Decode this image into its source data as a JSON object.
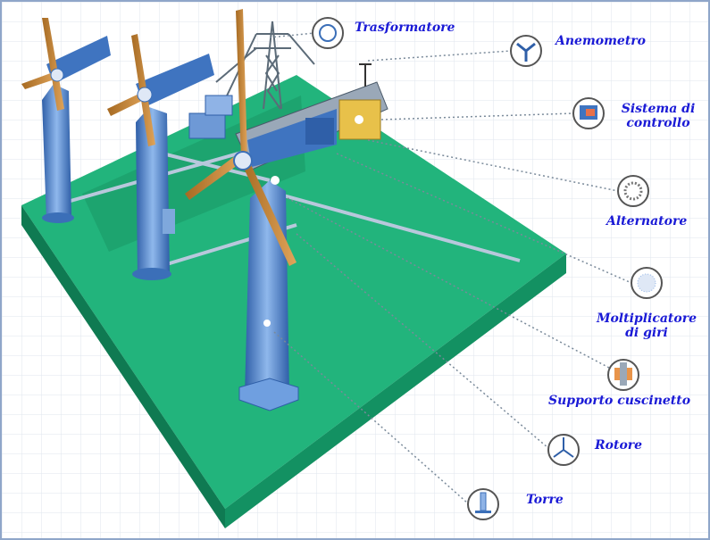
{
  "labels": {
    "trasformatore": "Trasformatore",
    "anemometro": "Anemometro",
    "sistema_line1": "Sistema di",
    "sistema_line2": "controllo",
    "alternatore": "Alternatore",
    "moltiplicatore_line1": "Moltiplicatore",
    "moltiplicatore_line2": "di giri",
    "supporto": "Supporto cuscinetto",
    "rotore": "Rotore",
    "torre": "Torre"
  },
  "colors": {
    "label_text": "#1a1ad6",
    "platform_top": "#1fb37a",
    "platform_side": "#0f7a52",
    "tower": "#5a8fd6",
    "blade": "#c98a3a",
    "nacelle": "#e8c14a",
    "grid": "#dde3ec"
  }
}
